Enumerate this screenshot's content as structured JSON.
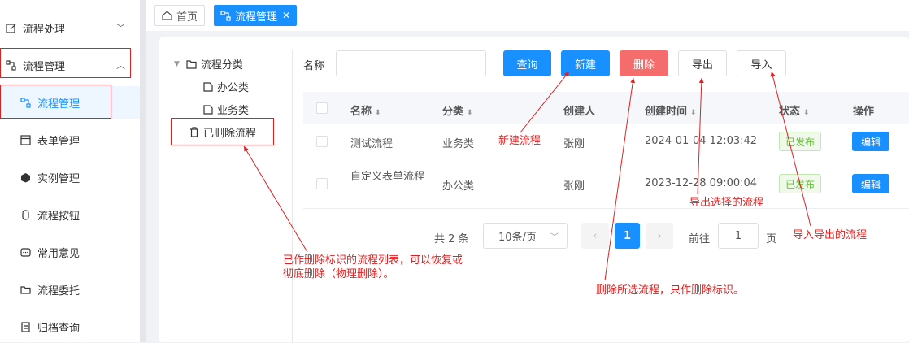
{
  "sidebar": {
    "items": [
      {
        "label": "流程处理",
        "icon": "edit-doc-icon"
      },
      {
        "label": "流程管理",
        "icon": "workflow-icon"
      },
      {
        "label": "流程管理",
        "icon": "workflow-icon"
      },
      {
        "label": "表单管理",
        "icon": "form-icon"
      },
      {
        "label": "实例管理",
        "icon": "cube-icon"
      },
      {
        "label": "流程按钮",
        "icon": "button-icon"
      },
      {
        "label": "常用意见",
        "icon": "comment-icon"
      },
      {
        "label": "流程委托",
        "icon": "folder-icon"
      },
      {
        "label": "归档查询",
        "icon": "archive-icon"
      }
    ]
  },
  "tabs": {
    "home": "首页",
    "active": "流程管理",
    "close": "✕"
  },
  "tree": {
    "root": "流程分类",
    "child1": "办公类",
    "child2": "业务类",
    "deleted": "已删除流程"
  },
  "search": {
    "label": "名称",
    "value": "",
    "placeholder": ""
  },
  "toolbar": {
    "query": "查询",
    "create": "新建",
    "delete": "删除",
    "export": "导出",
    "import": "导入"
  },
  "table": {
    "columns": [
      "名称",
      "分类",
      "创建人",
      "创建时间",
      "状态",
      "操作"
    ],
    "rows": [
      {
        "name": "测试流程",
        "category": "业务类",
        "creator": "张刚",
        "created": "2024-01-04 12:03:42",
        "status": "已发布",
        "action": "编辑"
      },
      {
        "name": "自定义表单流程",
        "category": "办公类",
        "creator": "张刚",
        "created": "2023-12-28 09:00:04",
        "status": "已发布",
        "action": "编辑"
      }
    ]
  },
  "pagination": {
    "total": "共 2 条",
    "page_size": "10条/页",
    "prev": "‹",
    "current": "1",
    "next": "›",
    "goto": "前往",
    "goto_value": "1",
    "page_unit": "页"
  },
  "notes": {
    "deleted_list": "已作删除标识的流程列表，可以恢复或",
    "deleted_list2": "彻底删除（物理删除）。",
    "create": "新建流程",
    "delete": "删除所选流程，只作删除标识。",
    "export": "导出选择的流程",
    "import": "导入导出的流程"
  },
  "colors": {
    "primary": "#1890ff",
    "danger": "#f56c6c",
    "success": "#67c23a",
    "annotation": "#e02020"
  }
}
